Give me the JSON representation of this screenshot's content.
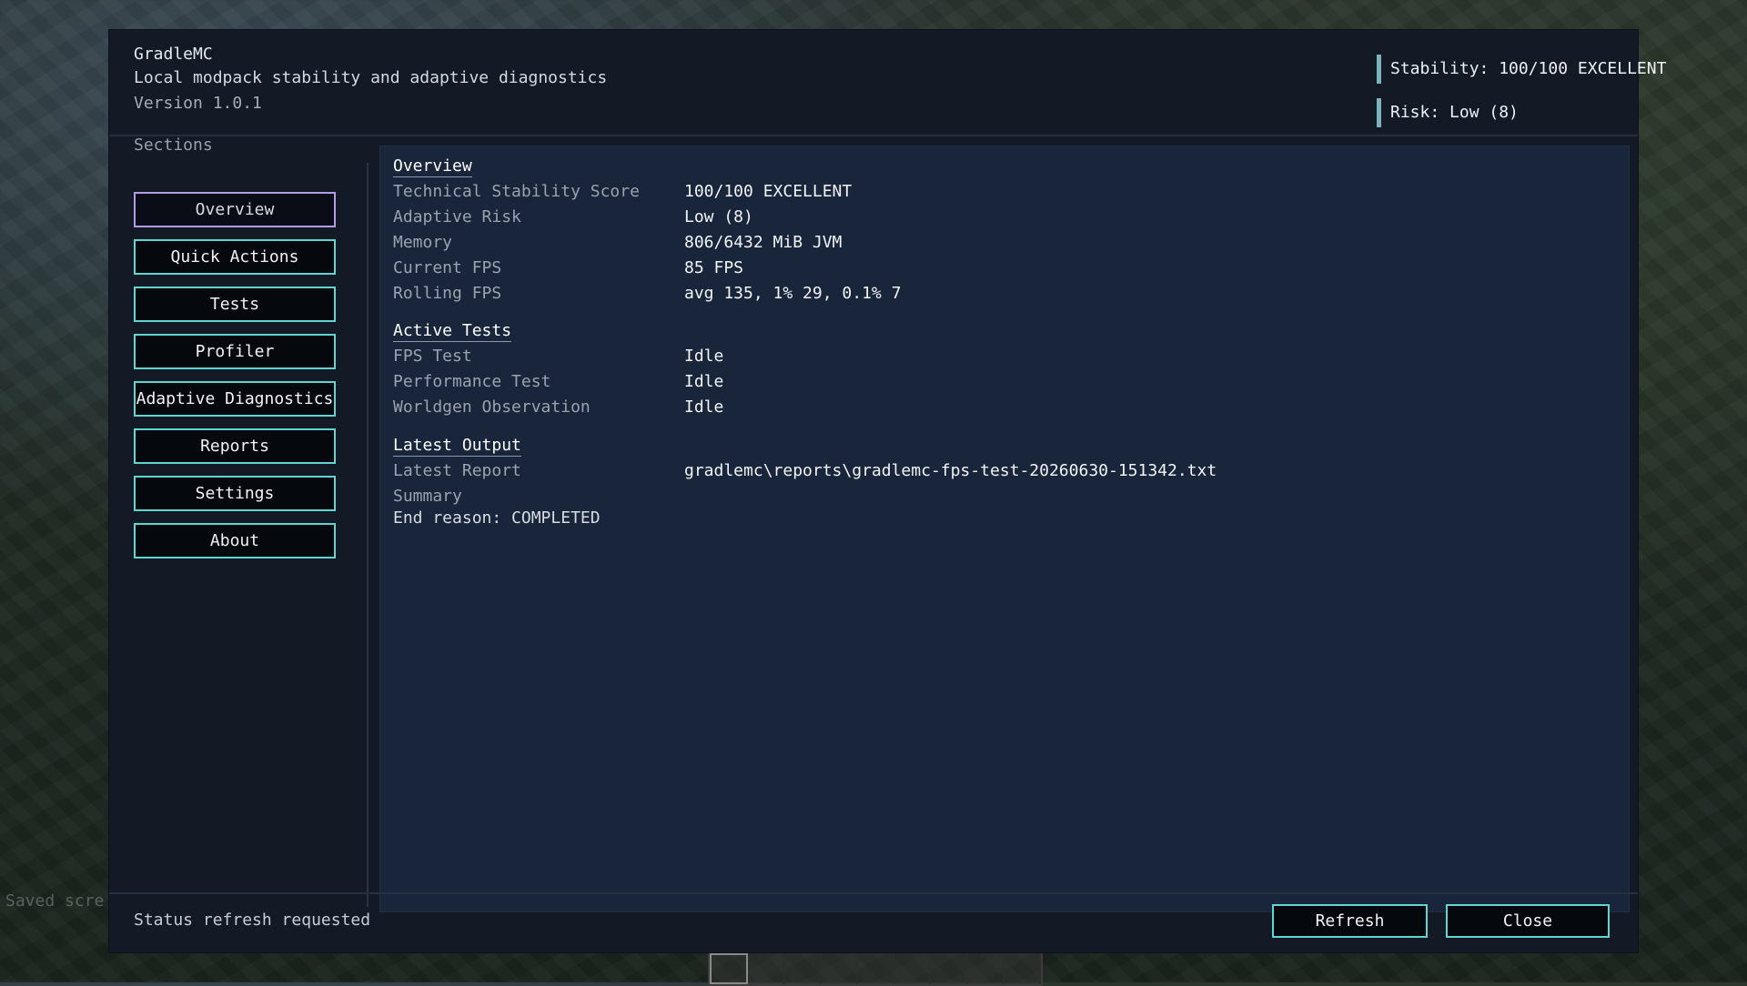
{
  "header": {
    "title": "GradleMC",
    "subtitle": "Local modpack stability and adaptive diagnostics",
    "version": "Version 1.0.1",
    "stability_badge": "Stability: 100/100 EXCELLENT",
    "risk_badge": "Risk: Low (8)",
    "accent_color": "#7ab3b8"
  },
  "sidebar": {
    "heading": "Sections",
    "active_color": "#b39be8",
    "button_border_color": "#5fd6cf",
    "items": [
      {
        "label": "Overview",
        "active": true
      },
      {
        "label": "Quick Actions"
      },
      {
        "label": "Tests"
      },
      {
        "label": "Profiler"
      },
      {
        "label": "Adaptive Diagnostics"
      },
      {
        "label": "Reports"
      },
      {
        "label": "Settings"
      },
      {
        "label": "About"
      }
    ]
  },
  "content": {
    "overview": {
      "title": "Overview",
      "rows": [
        {
          "label": "Technical Stability Score",
          "value": "100/100 EXCELLENT"
        },
        {
          "label": "Adaptive Risk",
          "value": "Low (8)"
        },
        {
          "label": "Memory",
          "value": "806/6432 MiB JVM"
        },
        {
          "label": "Current FPS",
          "value": "85 FPS"
        },
        {
          "label": "Rolling FPS",
          "value": "avg 135, 1% 29, 0.1% 7"
        }
      ]
    },
    "active_tests": {
      "title": "Active Tests",
      "rows": [
        {
          "label": "FPS Test",
          "value": "Idle"
        },
        {
          "label": "Performance Test",
          "value": "Idle"
        },
        {
          "label": "Worldgen Observation",
          "value": "Idle"
        }
      ]
    },
    "latest_output": {
      "title": "Latest Output",
      "rows": [
        {
          "label": "Latest Report",
          "value": "gradlemc\\reports\\gradlemc-fps-test-20260630-151342.txt"
        }
      ],
      "summary_label": "Summary",
      "summary_text": "End reason: COMPLETED"
    }
  },
  "footer": {
    "status": "Status refresh requested",
    "refresh_label": "Refresh",
    "close_label": "Close"
  },
  "overlay": {
    "chat_text": "Saved scre"
  }
}
